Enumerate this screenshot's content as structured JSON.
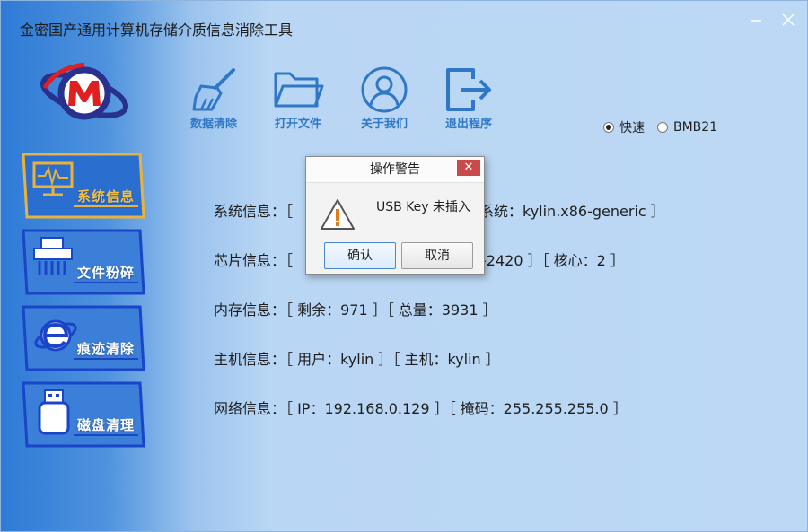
{
  "window": {
    "title": "金密国产通用计算机存储介质信息消除工具"
  },
  "toolbar": {
    "items": [
      {
        "label": "数据清除",
        "icon": "broom-icon"
      },
      {
        "label": "打开文件",
        "icon": "folder-icon"
      },
      {
        "label": "关于我们",
        "icon": "user-icon"
      },
      {
        "label": "退出程序",
        "icon": "exit-icon"
      }
    ]
  },
  "mode": {
    "options": [
      "快速",
      "BMB21"
    ],
    "selected": "快速"
  },
  "sidebar": {
    "items": [
      {
        "label": "系统信息",
        "icon": "monitor-icon",
        "active": true
      },
      {
        "label": "文件粉碎",
        "icon": "shredder-icon",
        "active": false
      },
      {
        "label": "痕迹清除",
        "icon": "browser-e-icon",
        "active": false
      },
      {
        "label": "磁盘清理",
        "icon": "usb-disk-icon",
        "active": false
      }
    ]
  },
  "info": {
    "system_pre": "系统信息：［",
    "system_tail": "系统：kylin.x86-generic ］",
    "chip_pre": "芯片信息：［",
    "chip_tail": "-2420 ］［ 核心：2 ］",
    "memory": "内存信息：［ 剩余：971 ］［ 总量：3931 ］",
    "host": "主机信息：［ 用户：kylin ］［ 主机：kylin ］",
    "network": "网络信息：［ IP：192.168.0.129 ］［ 掩码：255.255.255.0 ］"
  },
  "dialog": {
    "title": "操作警告",
    "message": "USB Key 未插入",
    "ok": "确认",
    "cancel": "取消"
  },
  "colors": {
    "sidebar_blue": "#1a45c8",
    "active_gold": "#e9b23a",
    "toolbar_icon": "#2f78c8",
    "warning_orange": "#e07b1d"
  }
}
